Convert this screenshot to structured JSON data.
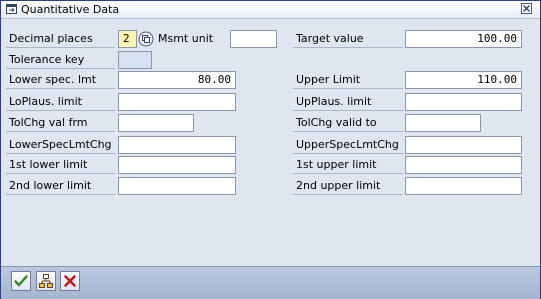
{
  "window": {
    "title": "Quantitative Data"
  },
  "icons": {
    "title": "dialog-icon",
    "close": "close-icon",
    "f4": "possible-entries-icon",
    "continue": "check-icon",
    "tree": "hierarchy-icon",
    "cancel": "cancel-icon"
  },
  "fields": {
    "decimal_places": {
      "label": "Decimal places",
      "value": "2"
    },
    "msmt_unit": {
      "label": "Msmt unit",
      "value": ""
    },
    "target_value": {
      "label": "Target value",
      "value": "100.00"
    },
    "tolerance_key": {
      "label": "Tolerance key",
      "value": ""
    },
    "lower_spec": {
      "label": "Lower spec. lmt",
      "value": "80.00"
    },
    "upper_limit": {
      "label": "Upper Limit",
      "value": "110.00"
    },
    "lo_plaus": {
      "label": "LoPlaus. limit",
      "value": ""
    },
    "up_plaus": {
      "label": "UpPlaus. limit",
      "value": ""
    },
    "tolchg_from": {
      "label": "TolChg val frm",
      "value": ""
    },
    "tolchg_to": {
      "label": "TolChg valid to",
      "value": ""
    },
    "lower_spec_chg": {
      "label": "LowerSpecLmtChg",
      "value": ""
    },
    "upper_spec_chg": {
      "label": "UpperSpecLmtChg",
      "value": ""
    },
    "first_lower": {
      "label": "1st lower limit",
      "value": ""
    },
    "first_upper": {
      "label": "1st upper limit",
      "value": ""
    },
    "second_lower": {
      "label": "2nd lower limit",
      "value": ""
    },
    "second_upper": {
      "label": "2nd upper limit",
      "value": ""
    }
  },
  "colors": {
    "background": "#dfe6f0",
    "field_required": "#fff6b0",
    "field_display": "#d6e2f2",
    "toolbar": "#a4b5d0"
  }
}
